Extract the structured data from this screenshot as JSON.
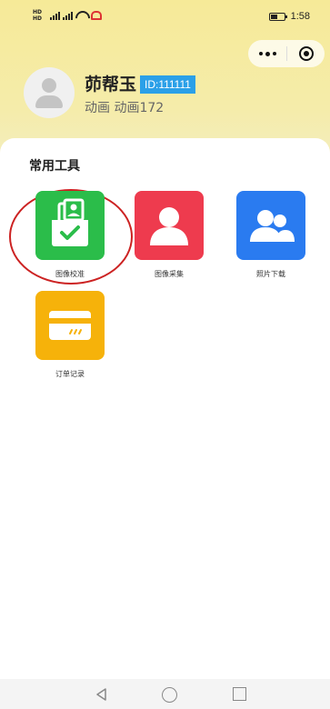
{
  "status_bar": {
    "sim1": "HD 4G",
    "sim2": "HD 4G",
    "battery_icon": "battery-icon",
    "time": "1:58"
  },
  "capsule": {
    "more_icon": "more-dots-icon",
    "close_icon": "target-icon"
  },
  "user": {
    "avatar_icon": "person-avatar-icon",
    "name": "茆帮玉",
    "id_badge": "ID:111111",
    "department": "动画 动画172"
  },
  "tools_section": {
    "title": "常用工具",
    "items": [
      {
        "label": "图像校准",
        "icon": "photo-calibrate-icon",
        "color": "#2bbd4a",
        "highlighted": true
      },
      {
        "label": "图像采集",
        "icon": "person-icon",
        "color": "#ee3b4e"
      },
      {
        "label": "照片下载",
        "icon": "group-icon",
        "color": "#2a7bf0"
      },
      {
        "label": "订单记录",
        "icon": "card-icon",
        "color": "#f6b20a"
      }
    ]
  },
  "nav_bar": {
    "back_icon": "back-triangle-icon",
    "home_icon": "home-circle-icon",
    "recent_icon": "recent-square-icon"
  }
}
